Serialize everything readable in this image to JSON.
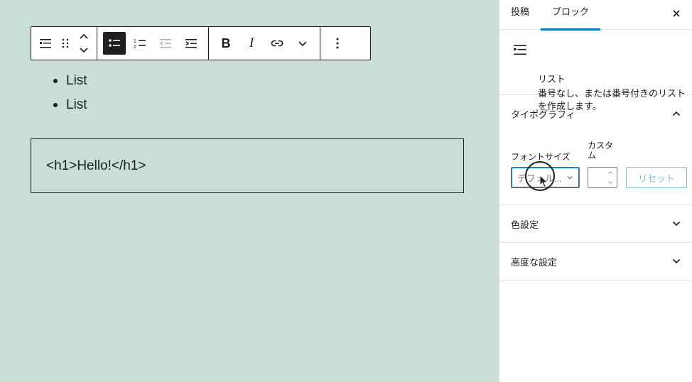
{
  "editor": {
    "list_items": [
      "List",
      "List"
    ],
    "html_block_text": "<h1>Hello!</h1>"
  },
  "toolbar": {
    "icons": [
      "list-block-icon",
      "drag-handle-icon",
      "move-up-icon",
      "move-down-icon",
      "unordered-list-icon",
      "ordered-list-icon",
      "outdent-icon",
      "indent-icon",
      "bold-icon",
      "italic-icon",
      "link-icon",
      "more-chevron-icon",
      "options-icon"
    ],
    "bold_label": "B",
    "italic_label": "I"
  },
  "sidebar": {
    "tabs": [
      {
        "label": "投稿"
      },
      {
        "label": "ブロック"
      }
    ],
    "block_card": {
      "title": "リスト",
      "description": "番号なし、または番号付きのリストを作成します。"
    },
    "typography": {
      "title": "タイポグラフィ",
      "font_size_label": "フォントサイズ",
      "custom_label": "カスタム",
      "select_value": "デフォル...",
      "custom_value": "",
      "reset_label": "リセット"
    },
    "color_panel": {
      "title": "色設定"
    },
    "advanced_panel": {
      "title": "高度な設定"
    }
  },
  "colors": {
    "canvas_bg": "#cadfd8",
    "accent": "#007cba",
    "reset_disabled": "#7fbfdd"
  }
}
